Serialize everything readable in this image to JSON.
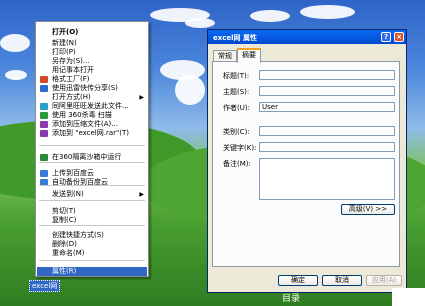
{
  "menu": {
    "items": [
      {
        "label": "打开(O)",
        "bold": true
      },
      {
        "label": "新建(N)"
      },
      {
        "label": "打印(P)"
      },
      {
        "label": "另存为(S)..."
      },
      {
        "label": "用记事本打开"
      },
      {
        "label": "格式工厂(F)",
        "icon": "format-factory-icon",
        "color": "#d04a2a"
      },
      {
        "label": "使用迅雷快传分享(S)",
        "icon": "thunder-icon",
        "color": "#2a6bd0"
      },
      {
        "label": "打开方式(H)"
      },
      {
        "label": "同阿里旺旺发送此文件...",
        "icon": "wangwang-icon",
        "color": "#2aa0d0"
      },
      {
        "label": "使用 360杀毒 扫描",
        "icon": "360-antivirus-icon",
        "color": "#2a9a3a"
      },
      {
        "label": "添加到压缩文件(A)...",
        "icon": "archive-icon",
        "color": "#8a3ab0"
      },
      {
        "label": "添加到 \"excel网.rar\"(T)",
        "icon": "archive-icon",
        "color": "#8a3ab0"
      },
      {
        "label": "在360隔离沙箱中运行",
        "icon": "sandbox-icon",
        "color": "#2a8a3a"
      },
      {
        "label": "上传到百度云",
        "icon": "baidu-cloud-icon",
        "color": "#3a7ad8"
      },
      {
        "label": "自动备份到百度云",
        "icon": "baidu-cloud-icon",
        "color": "#3a7ad8"
      },
      {
        "label": "发送到(N)"
      },
      {
        "label": "剪切(T)"
      },
      {
        "label": "复制(C)"
      },
      {
        "label": "创建快捷方式(S)"
      },
      {
        "label": "删除(D)"
      },
      {
        "label": "重命名(M)"
      },
      {
        "label": "属性(R)"
      }
    ]
  },
  "desktop_icon_label": "excel网",
  "dialog": {
    "title": "excel网 属性",
    "tabs": [
      "常规",
      "摘要"
    ],
    "fields": [
      {
        "label": "标题(T):",
        "value": ""
      },
      {
        "label": "主题(S):",
        "value": ""
      },
      {
        "label": "作者(U):",
        "value": "User"
      },
      {
        "label": "类别(C):",
        "value": ""
      },
      {
        "label": "关键字(K):",
        "value": ""
      },
      {
        "label": "备注(M):",
        "value": ""
      }
    ],
    "advanced_button": "高级(V) >>",
    "ok_button": "确定",
    "cancel_button": "取消",
    "apply_button": "应用(A)"
  },
  "watermark_text": "目录"
}
